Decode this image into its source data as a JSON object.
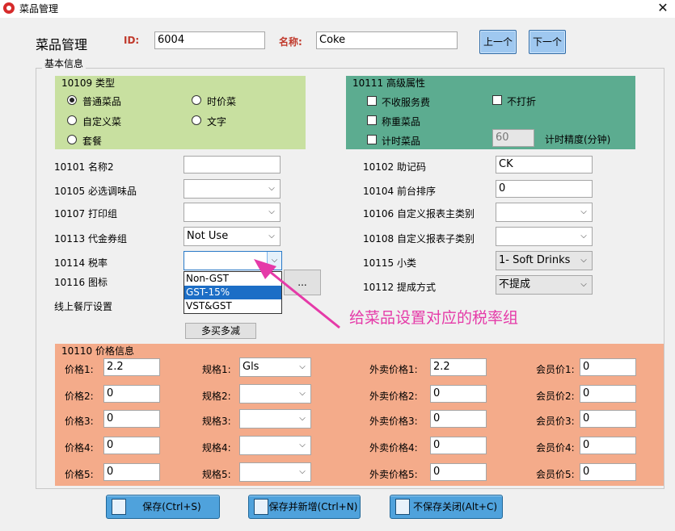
{
  "window": {
    "title": "菜品管理"
  },
  "header": {
    "page_title": "菜品管理",
    "id_label": "ID:",
    "id_value": "6004",
    "name_label": "名称:",
    "name_value": "Coke",
    "prev_label": "上一个",
    "next_label": "下一个"
  },
  "basic_info": {
    "legend": "基本信息"
  },
  "type_panel": {
    "title": "10109 类型",
    "options": [
      {
        "label": "普通菜品",
        "checked": true
      },
      {
        "label": "时价菜",
        "checked": false
      },
      {
        "label": "自定义菜",
        "checked": false
      },
      {
        "label": "文字",
        "checked": false
      },
      {
        "label": "套餐",
        "checked": false
      }
    ]
  },
  "advanced_panel": {
    "title": "10111 高级属性",
    "no_service_fee": "不收服务费",
    "no_discount": "不打折",
    "weighed_item": "称重菜品",
    "timed_item": "计时菜品",
    "time_precision_value": "60",
    "time_precision_label": "计时精度(分钟)"
  },
  "left_fields": {
    "name2_label": "10101 名称2",
    "name2_value": "",
    "seasoning_label": "10105 必选调味品",
    "seasoning_value": "",
    "print_group_label": "10107 打印组",
    "print_group_value": "",
    "voucher_label": "10113 代金券组",
    "voucher_value": "Not Use",
    "tax_label": "10114 税率",
    "tax_value": "",
    "icon_label": "10116 图标",
    "icon_button": "...",
    "online_label": "线上餐厅设置",
    "multi_buy_button": "多买多减"
  },
  "tax_dropdown": {
    "options": [
      "Non-GST",
      "GST-15%",
      "VST&GST"
    ],
    "highlighted": "GST-15%"
  },
  "right_fields": {
    "mnemonic_label": "10102 助记码",
    "mnemonic_value": "CK",
    "sort_label": "10104 前台排序",
    "sort_value": "0",
    "report_main_label": "10106 自定义报表主类别",
    "report_main_value": "",
    "report_sub_label": "10108 自定义报表子类别",
    "report_sub_value": "",
    "subclass_label": "10115 小类",
    "subclass_value": "1- Soft Drinks",
    "commission_label": "10112 提成方式",
    "commission_value": "不提成"
  },
  "price_panel": {
    "title": "10110 价格信息",
    "rows": [
      {
        "price_label": "价格1:",
        "price": "2.2",
        "spec_label": "规格1:",
        "spec": "Gls",
        "takeaway_label": "外卖价格1:",
        "takeaway": "2.2",
        "member_label": "会员价1:",
        "member": "0"
      },
      {
        "price_label": "价格2:",
        "price": "0",
        "spec_label": "规格2:",
        "spec": "",
        "takeaway_label": "外卖价格2:",
        "takeaway": "0",
        "member_label": "会员价2:",
        "member": "0"
      },
      {
        "price_label": "价格3:",
        "price": "0",
        "spec_label": "规格3:",
        "spec": "",
        "takeaway_label": "外卖价格3:",
        "takeaway": "0",
        "member_label": "会员价3:",
        "member": "0"
      },
      {
        "price_label": "价格4:",
        "price": "0",
        "spec_label": "规格4:",
        "spec": "",
        "takeaway_label": "外卖价格4:",
        "takeaway": "0",
        "member_label": "会员价4:",
        "member": "0"
      },
      {
        "price_label": "价格5:",
        "price": "0",
        "spec_label": "规格5:",
        "spec": "",
        "takeaway_label": "外卖价格5:",
        "takeaway": "0",
        "member_label": "会员价5:",
        "member": "0"
      }
    ]
  },
  "buttons": {
    "save": "保存(Ctrl+S)",
    "save_new": "保存并新增(Ctrl+N)",
    "close_nosave": "不保存关闭(Alt+C)"
  },
  "annotation": {
    "text": "给菜品设置对应的税率组",
    "color": "#e53aa8"
  },
  "colors": {
    "type_panel": "#c8e0a0",
    "advanced_panel": "#5cac90",
    "price_panel": "#f4ab8a",
    "highlight": "#1c6ec6"
  }
}
